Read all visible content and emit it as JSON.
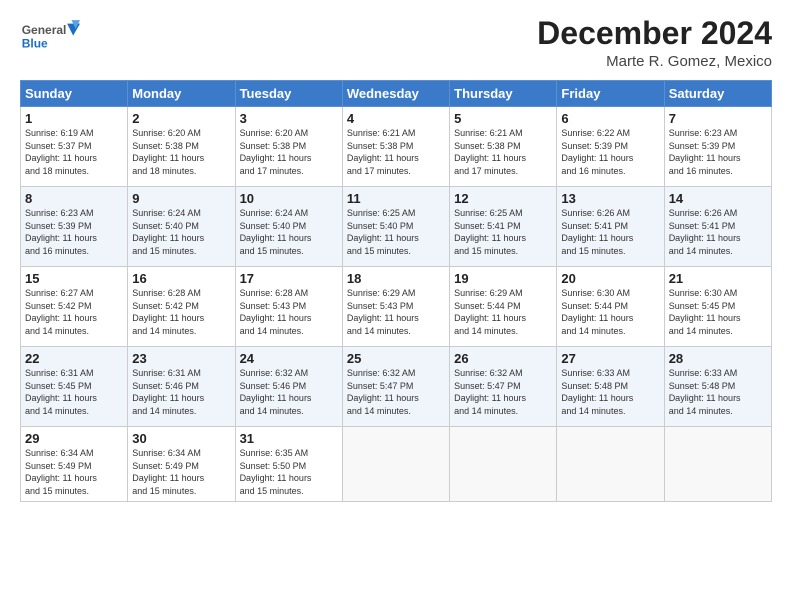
{
  "header": {
    "logo": {
      "line1": "General",
      "line2": "Blue"
    },
    "month": "December 2024",
    "location": "Marte R. Gomez, Mexico"
  },
  "weekdays": [
    "Sunday",
    "Monday",
    "Tuesday",
    "Wednesday",
    "Thursday",
    "Friday",
    "Saturday"
  ],
  "weeks": [
    [
      {
        "day": "1",
        "lines": [
          "Sunrise: 6:19 AM",
          "Sunset: 5:37 PM",
          "Daylight: 11 hours",
          "and 18 minutes."
        ]
      },
      {
        "day": "2",
        "lines": [
          "Sunrise: 6:20 AM",
          "Sunset: 5:38 PM",
          "Daylight: 11 hours",
          "and 18 minutes."
        ]
      },
      {
        "day": "3",
        "lines": [
          "Sunrise: 6:20 AM",
          "Sunset: 5:38 PM",
          "Daylight: 11 hours",
          "and 17 minutes."
        ]
      },
      {
        "day": "4",
        "lines": [
          "Sunrise: 6:21 AM",
          "Sunset: 5:38 PM",
          "Daylight: 11 hours",
          "and 17 minutes."
        ]
      },
      {
        "day": "5",
        "lines": [
          "Sunrise: 6:21 AM",
          "Sunset: 5:38 PM",
          "Daylight: 11 hours",
          "and 17 minutes."
        ]
      },
      {
        "day": "6",
        "lines": [
          "Sunrise: 6:22 AM",
          "Sunset: 5:39 PM",
          "Daylight: 11 hours",
          "and 16 minutes."
        ]
      },
      {
        "day": "7",
        "lines": [
          "Sunrise: 6:23 AM",
          "Sunset: 5:39 PM",
          "Daylight: 11 hours",
          "and 16 minutes."
        ]
      }
    ],
    [
      {
        "day": "8",
        "lines": [
          "Sunrise: 6:23 AM",
          "Sunset: 5:39 PM",
          "Daylight: 11 hours",
          "and 16 minutes."
        ]
      },
      {
        "day": "9",
        "lines": [
          "Sunrise: 6:24 AM",
          "Sunset: 5:40 PM",
          "Daylight: 11 hours",
          "and 15 minutes."
        ]
      },
      {
        "day": "10",
        "lines": [
          "Sunrise: 6:24 AM",
          "Sunset: 5:40 PM",
          "Daylight: 11 hours",
          "and 15 minutes."
        ]
      },
      {
        "day": "11",
        "lines": [
          "Sunrise: 6:25 AM",
          "Sunset: 5:40 PM",
          "Daylight: 11 hours",
          "and 15 minutes."
        ]
      },
      {
        "day": "12",
        "lines": [
          "Sunrise: 6:25 AM",
          "Sunset: 5:41 PM",
          "Daylight: 11 hours",
          "and 15 minutes."
        ]
      },
      {
        "day": "13",
        "lines": [
          "Sunrise: 6:26 AM",
          "Sunset: 5:41 PM",
          "Daylight: 11 hours",
          "and 15 minutes."
        ]
      },
      {
        "day": "14",
        "lines": [
          "Sunrise: 6:26 AM",
          "Sunset: 5:41 PM",
          "Daylight: 11 hours",
          "and 14 minutes."
        ]
      }
    ],
    [
      {
        "day": "15",
        "lines": [
          "Sunrise: 6:27 AM",
          "Sunset: 5:42 PM",
          "Daylight: 11 hours",
          "and 14 minutes."
        ]
      },
      {
        "day": "16",
        "lines": [
          "Sunrise: 6:28 AM",
          "Sunset: 5:42 PM",
          "Daylight: 11 hours",
          "and 14 minutes."
        ]
      },
      {
        "day": "17",
        "lines": [
          "Sunrise: 6:28 AM",
          "Sunset: 5:43 PM",
          "Daylight: 11 hours",
          "and 14 minutes."
        ]
      },
      {
        "day": "18",
        "lines": [
          "Sunrise: 6:29 AM",
          "Sunset: 5:43 PM",
          "Daylight: 11 hours",
          "and 14 minutes."
        ]
      },
      {
        "day": "19",
        "lines": [
          "Sunrise: 6:29 AM",
          "Sunset: 5:44 PM",
          "Daylight: 11 hours",
          "and 14 minutes."
        ]
      },
      {
        "day": "20",
        "lines": [
          "Sunrise: 6:30 AM",
          "Sunset: 5:44 PM",
          "Daylight: 11 hours",
          "and 14 minutes."
        ]
      },
      {
        "day": "21",
        "lines": [
          "Sunrise: 6:30 AM",
          "Sunset: 5:45 PM",
          "Daylight: 11 hours",
          "and 14 minutes."
        ]
      }
    ],
    [
      {
        "day": "22",
        "lines": [
          "Sunrise: 6:31 AM",
          "Sunset: 5:45 PM",
          "Daylight: 11 hours",
          "and 14 minutes."
        ]
      },
      {
        "day": "23",
        "lines": [
          "Sunrise: 6:31 AM",
          "Sunset: 5:46 PM",
          "Daylight: 11 hours",
          "and 14 minutes."
        ]
      },
      {
        "day": "24",
        "lines": [
          "Sunrise: 6:32 AM",
          "Sunset: 5:46 PM",
          "Daylight: 11 hours",
          "and 14 minutes."
        ]
      },
      {
        "day": "25",
        "lines": [
          "Sunrise: 6:32 AM",
          "Sunset: 5:47 PM",
          "Daylight: 11 hours",
          "and 14 minutes."
        ]
      },
      {
        "day": "26",
        "lines": [
          "Sunrise: 6:32 AM",
          "Sunset: 5:47 PM",
          "Daylight: 11 hours",
          "and 14 minutes."
        ]
      },
      {
        "day": "27",
        "lines": [
          "Sunrise: 6:33 AM",
          "Sunset: 5:48 PM",
          "Daylight: 11 hours",
          "and 14 minutes."
        ]
      },
      {
        "day": "28",
        "lines": [
          "Sunrise: 6:33 AM",
          "Sunset: 5:48 PM",
          "Daylight: 11 hours",
          "and 14 minutes."
        ]
      }
    ],
    [
      {
        "day": "29",
        "lines": [
          "Sunrise: 6:34 AM",
          "Sunset: 5:49 PM",
          "Daylight: 11 hours",
          "and 15 minutes."
        ]
      },
      {
        "day": "30",
        "lines": [
          "Sunrise: 6:34 AM",
          "Sunset: 5:49 PM",
          "Daylight: 11 hours",
          "and 15 minutes."
        ]
      },
      {
        "day": "31",
        "lines": [
          "Sunrise: 6:35 AM",
          "Sunset: 5:50 PM",
          "Daylight: 11 hours",
          "and 15 minutes."
        ]
      },
      {
        "day": "",
        "lines": []
      },
      {
        "day": "",
        "lines": []
      },
      {
        "day": "",
        "lines": []
      },
      {
        "day": "",
        "lines": []
      }
    ]
  ]
}
